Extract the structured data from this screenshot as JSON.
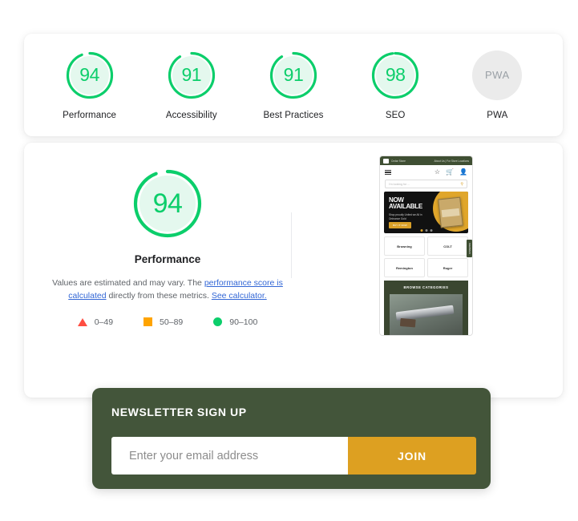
{
  "summary": {
    "gauges": [
      {
        "label": "Performance",
        "value": "94",
        "score": 94,
        "color": "#0cce6b",
        "fill": "#e4f8ee",
        "type": "ring"
      },
      {
        "label": "Accessibility",
        "value": "91",
        "score": 91,
        "color": "#0cce6b",
        "fill": "#e4f8ee",
        "type": "ring"
      },
      {
        "label": "Best Practices",
        "value": "91",
        "score": 91,
        "color": "#0cce6b",
        "fill": "#e4f8ee",
        "type": "ring"
      },
      {
        "label": "SEO",
        "value": "98",
        "score": 98,
        "color": "#0cce6b",
        "fill": "#e4f8ee",
        "type": "ring"
      },
      {
        "label": "PWA",
        "value": "PWA",
        "score": 0,
        "color": "#9aa0a6",
        "fill": "#ebebeb",
        "type": "flat"
      }
    ]
  },
  "detail": {
    "gauge": {
      "label": "Performance",
      "value": "94",
      "score": 94,
      "color": "#0cce6b",
      "fill": "#e4f8ee"
    },
    "description": {
      "part1": "Values are estimated and may vary. The ",
      "link1": "performance score is calculated",
      "part2": " directly from these metrics. ",
      "link2": "See calculator."
    },
    "legend": [
      {
        "shape": "triangle",
        "range": "0–49",
        "color": "#ff4e42"
      },
      {
        "shape": "square",
        "range": "50–89",
        "color": "#ffa400"
      },
      {
        "shape": "circle",
        "range": "90–100",
        "color": "#0cce6b"
      }
    ]
  },
  "screenshot": {
    "topbar": {
      "brand": "Cedar Stone",
      "right": "About Us  |  For Store Locations"
    },
    "search_placeholder": "I'm looking for ...",
    "hero": {
      "title_line1": "NOW",
      "title_line2": "AVAILABLE",
      "subtitle": "Shop proudly United we All in Ordnance Gold",
      "button": "BUY IT NOW",
      "dots": 3
    },
    "brands": [
      "Browning",
      "COLT",
      "Remington",
      "Ruger"
    ],
    "side_tab": "FEEDBACK",
    "categories_title": "BROWSE CATEGORIES"
  },
  "newsletter": {
    "title": "NEWSLETTER SIGN UP",
    "email_placeholder": "Enter your email address",
    "email_value": "",
    "join_label": "JOIN",
    "panel_color": "#43553a",
    "button_color": "#dda021"
  }
}
